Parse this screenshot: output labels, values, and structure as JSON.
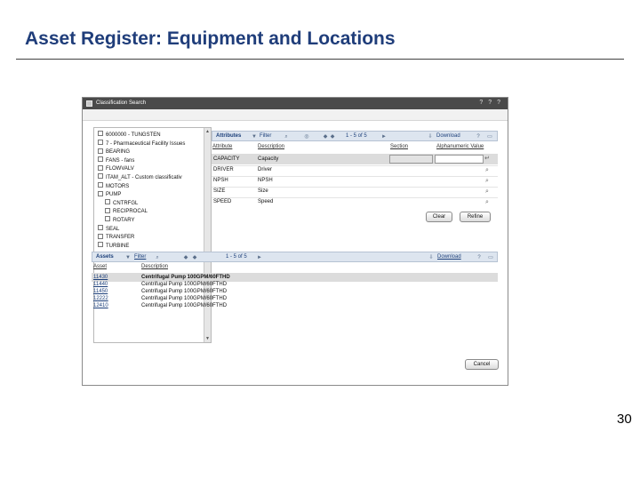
{
  "slide": {
    "title": "Asset Register: Equipment and Locations",
    "page_number": "30"
  },
  "window": {
    "title": "Classification Search",
    "title_buttons": "? ? ?"
  },
  "tree": {
    "items": [
      {
        "toggle": "minus",
        "label": "6000000 - TUNGSTEN",
        "indent": 0
      },
      {
        "toggle": "minus",
        "label": "7 - Pharmaceutical Facility Issues",
        "indent": 0
      },
      {
        "toggle": "plus",
        "label": "BEARING",
        "indent": 0
      },
      {
        "toggle": "plus",
        "label": "FANS - fans",
        "indent": 0
      },
      {
        "toggle": "plus",
        "label": "FLOWVALV",
        "indent": 0
      },
      {
        "toggle": "plus",
        "label": "ITAM_ALT - Custom classificativ",
        "indent": 0
      },
      {
        "toggle": "plus",
        "label": "MOTORS",
        "indent": 0
      },
      {
        "toggle": "minus",
        "label": "PUMP",
        "indent": 0
      },
      {
        "toggle": "plus",
        "label": "CNTRFGL",
        "indent": 1
      },
      {
        "toggle": "plus",
        "label": "RECIPROCAL",
        "indent": 1
      },
      {
        "toggle": "plus",
        "label": "ROTARY",
        "indent": 1
      },
      {
        "toggle": "plus",
        "label": "SEAL",
        "indent": 0
      },
      {
        "toggle": "plus",
        "label": "TRANSFER",
        "indent": 0
      },
      {
        "toggle": "plus",
        "label": "TURBINE",
        "indent": 0
      }
    ]
  },
  "attributes": {
    "title": "Attributes",
    "filter": "Filter",
    "pager": "1 - 5 of 5",
    "download": "Download",
    "columns": [
      "Attribute",
      "Description",
      "Section",
      "Alphanumeric Value"
    ],
    "rows": [
      {
        "attribute": "CAPACITY",
        "description": "Capacity",
        "selected": true
      },
      {
        "attribute": "DRIVER",
        "description": "Driver",
        "selected": false
      },
      {
        "attribute": "NPSH",
        "description": "NPSH",
        "selected": false
      },
      {
        "attribute": "SIZE",
        "description": "Size",
        "selected": false
      },
      {
        "attribute": "SPEED",
        "description": "Speed",
        "selected": false
      }
    ],
    "clear_label": "Clear",
    "refine_label": "Refine"
  },
  "assets": {
    "title": "Assets",
    "filter": "Filter",
    "pager": "1 - 5 of 5",
    "download": "Download",
    "columns": [
      "Asset",
      "Description"
    ],
    "rows": [
      {
        "asset": "11430",
        "description": "Centrifugal Pump 100GPM/60FTHD",
        "selected": true
      },
      {
        "asset": "11440",
        "description": "Centrifugal Pump 100GPM/60FTHD",
        "selected": false
      },
      {
        "asset": "11450",
        "description": "Centrifugal Pump 100GPM/60FTHD",
        "selected": false
      },
      {
        "asset": "12222",
        "description": "Centrifugal Pump 100GPM/60FTHD",
        "selected": false
      },
      {
        "asset": "12410",
        "description": "Centrifugal Pump 100GPM/60FTHD",
        "selected": false
      }
    ]
  },
  "cancel_label": "Cancel",
  "colors": {
    "title_blue": "#1f3d7a",
    "panel_header": "#dde5ef",
    "window_titlebar": "#4a4a4a",
    "selected_row": "#dcdcdc"
  },
  "icons": [
    "window-icon",
    "filter-icon",
    "search-icon",
    "pager-arrows",
    "download-icon",
    "help-icon",
    "maximize-icon",
    "enter-icon",
    "magnifier-icon"
  ]
}
